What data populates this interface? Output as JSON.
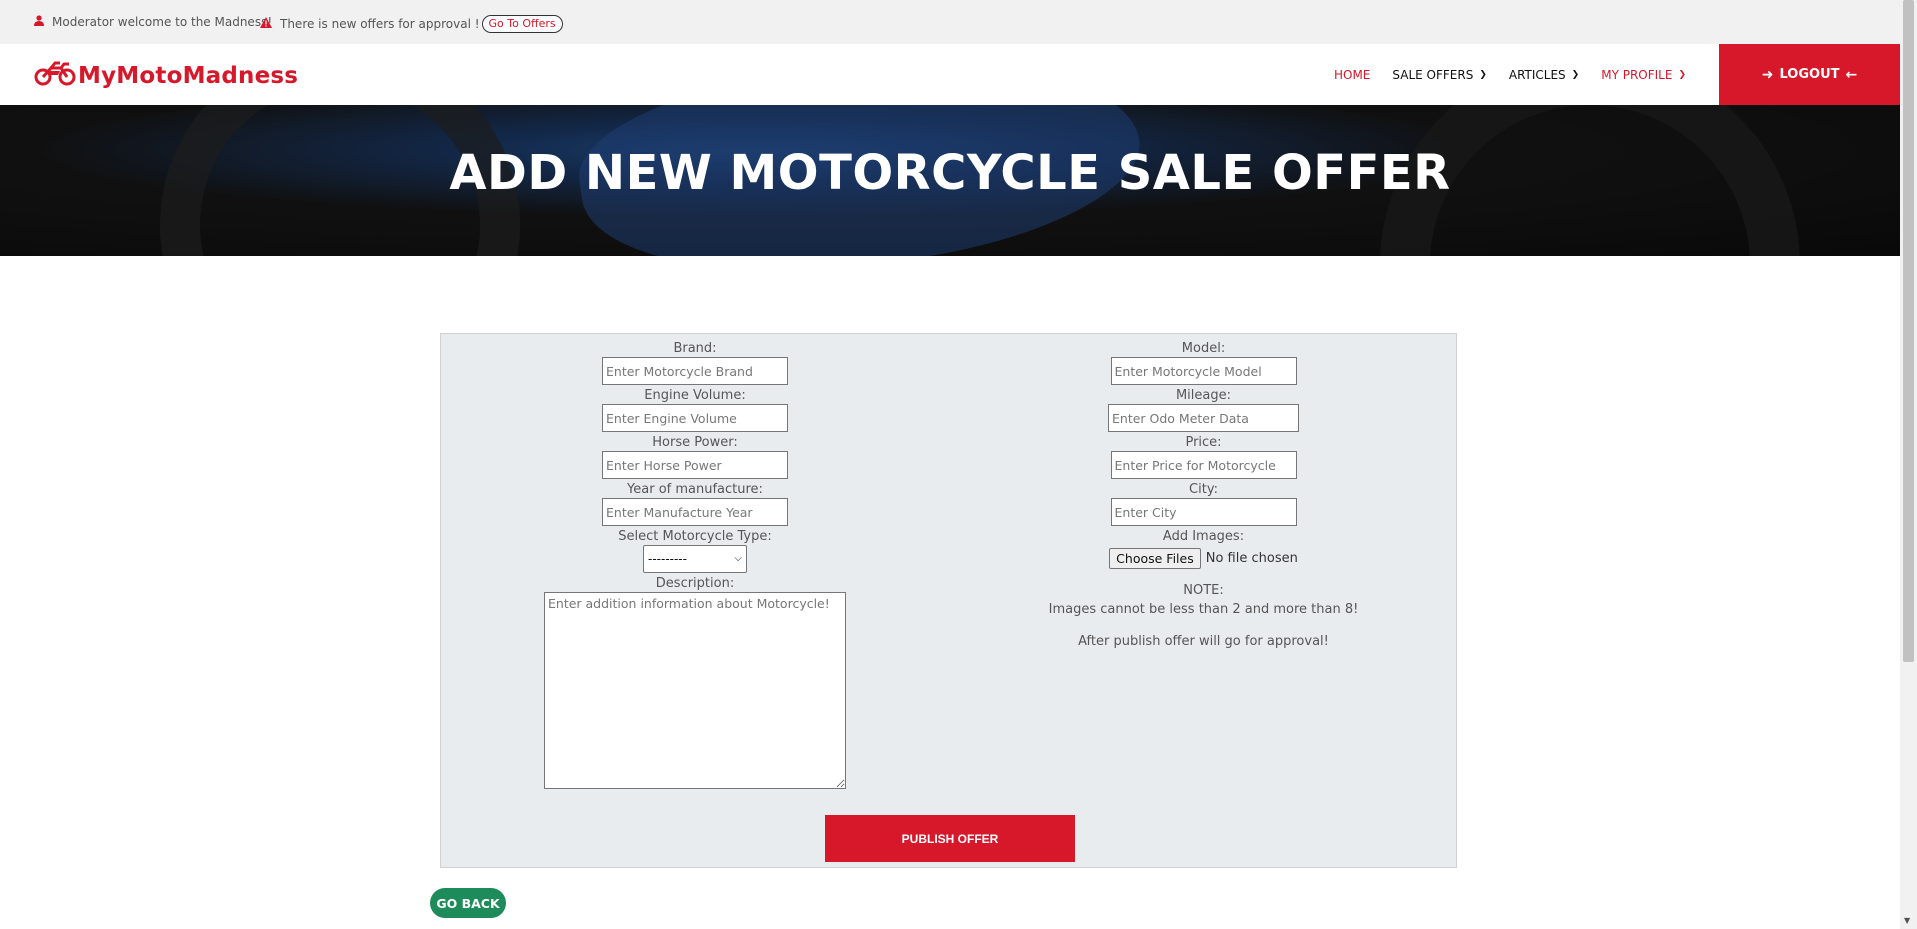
{
  "topbar": {
    "user_message": "Moderator welcome to the Madness!",
    "alert_message": "There is new offers for approval !",
    "go_offers_label": "Go To Offers"
  },
  "navbar": {
    "brand": "MyMotoMadness",
    "links": [
      {
        "label": "HOME",
        "active": true
      },
      {
        "label": "SALE OFFERS",
        "has_dropdown": true
      },
      {
        "label": "ARTICLES",
        "has_dropdown": true
      },
      {
        "label": "MY PROFILE",
        "has_dropdown": true,
        "active": true
      }
    ],
    "logout_label": "LOGOUT"
  },
  "hero": {
    "title": "ADD NEW MOTORCYCLE SALE OFFER"
  },
  "form": {
    "brand": {
      "label": "Brand:",
      "placeholder": "Enter Motorcycle Brand",
      "value": ""
    },
    "engine_volume": {
      "label": "Engine Volume:",
      "placeholder": "Enter Engine Volume",
      "value": ""
    },
    "horse_power": {
      "label": "Horse Power:",
      "placeholder": "Enter Horse Power",
      "value": ""
    },
    "year": {
      "label": "Year of manufacture:",
      "placeholder": "Enter Manufacture Year",
      "value": ""
    },
    "type": {
      "label": "Select Motorcycle Type:",
      "selected": "---------"
    },
    "description": {
      "label": "Description:",
      "placeholder": "Enter addition information about Motorcycle!",
      "value": ""
    },
    "model": {
      "label": "Model:",
      "placeholder": "Enter Motorcycle Model",
      "value": ""
    },
    "mileage": {
      "label": "Mileage:",
      "placeholder": "Enter Odo Meter Data",
      "value": ""
    },
    "price": {
      "label": "Price:",
      "placeholder": "Enter Price for Motorcycle",
      "value": ""
    },
    "city": {
      "label": "City:",
      "placeholder": "Enter City",
      "value": ""
    },
    "images": {
      "label": "Add Images:",
      "button_label": "Choose Files",
      "status": "No file chosen"
    },
    "note_title": "NOTE:",
    "note_images": "Images cannot be less than 2 and more than 8!",
    "note_approval": "After publish offer will go for approval!",
    "publish_label": "PUBLISH OFFER"
  },
  "go_back_label": "GO BACK",
  "colors": {
    "accent": "#d7172a",
    "go_back": "#1e8b5a",
    "panel_bg": "#e9ecef"
  },
  "icons": {
    "user": "user-icon",
    "alert": "warning-icon",
    "logo": "motorcycle-icon",
    "logout": "arrow-right-icon",
    "logout_back": "arrow-left-icon"
  }
}
